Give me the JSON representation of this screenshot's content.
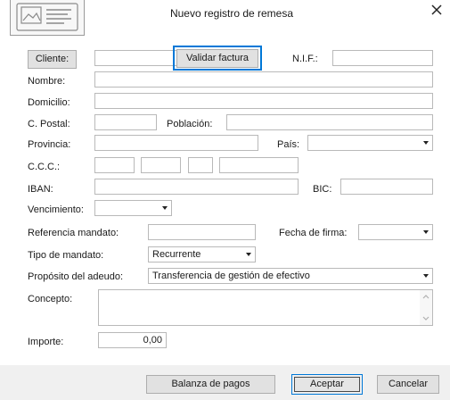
{
  "title": "Nuevo registro de remesa",
  "icons": {
    "logo": "document-card-icon",
    "close": "close-icon"
  },
  "labels": {
    "nombre": "Nombre:",
    "domicilio": "Domicilio:",
    "cpostal": "C. Postal:",
    "poblacion": "Población:",
    "provincia": "Provincia:",
    "pais": "País:",
    "ccc": "C.C.C.:",
    "iban": "IBAN:",
    "bic": "BIC:",
    "vencimiento": "Vencimiento:",
    "referencia": "Referencia mandato:",
    "fecha_firma": "Fecha de firma:",
    "tipo_mandato": "Tipo de mandato:",
    "proposito": "Propósito del adeudo:",
    "concepto": "Concepto:",
    "importe": "Importe:",
    "nif": "N.I.F.:"
  },
  "buttons": {
    "cliente": "Cliente:",
    "validar": "Validar factura",
    "balanza": "Balanza de pagos",
    "aceptar": "Aceptar",
    "cancelar": "Cancelar"
  },
  "values": {
    "tipo_mandato": "Recurrente",
    "proposito": "Transferencia de gestión de efectivo",
    "importe": "0,00"
  },
  "colors": {
    "focus": "#0078d7",
    "footer": "#f0f0f0",
    "border": "#b9b9b9"
  }
}
